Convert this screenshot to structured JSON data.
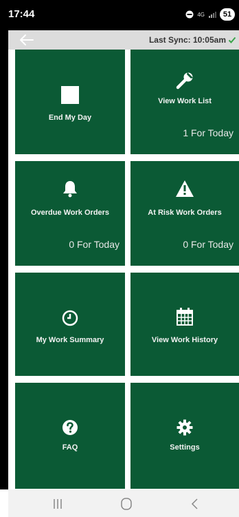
{
  "status_bar": {
    "time": "17:44",
    "network": "4G",
    "battery": "51"
  },
  "action_bar": {
    "sync_text": "Last Sync: 10:05am",
    "sync_ok_color": "#3aa34a"
  },
  "tiles": [
    {
      "label": "End My Day",
      "icon": "stop-square-icon",
      "count": ""
    },
    {
      "label": "View Work List",
      "icon": "wrench-icon",
      "count": "1 For Today"
    },
    {
      "label": "Overdue Work Orders",
      "icon": "bell-icon",
      "count": "0 For Today"
    },
    {
      "label": "At Risk Work Orders",
      "icon": "warning-triangle-icon",
      "count": "0 For Today"
    },
    {
      "label": "My Work Summary",
      "icon": "clock-icon",
      "count": ""
    },
    {
      "label": "View Work History",
      "icon": "calendar-icon",
      "count": ""
    },
    {
      "label": "FAQ",
      "icon": "question-circle-icon",
      "count": ""
    },
    {
      "label": "Settings",
      "icon": "gear-icon",
      "count": ""
    }
  ],
  "colors": {
    "tile_green": "#0b5a35",
    "action_bar_bg": "#dcdcdc"
  }
}
